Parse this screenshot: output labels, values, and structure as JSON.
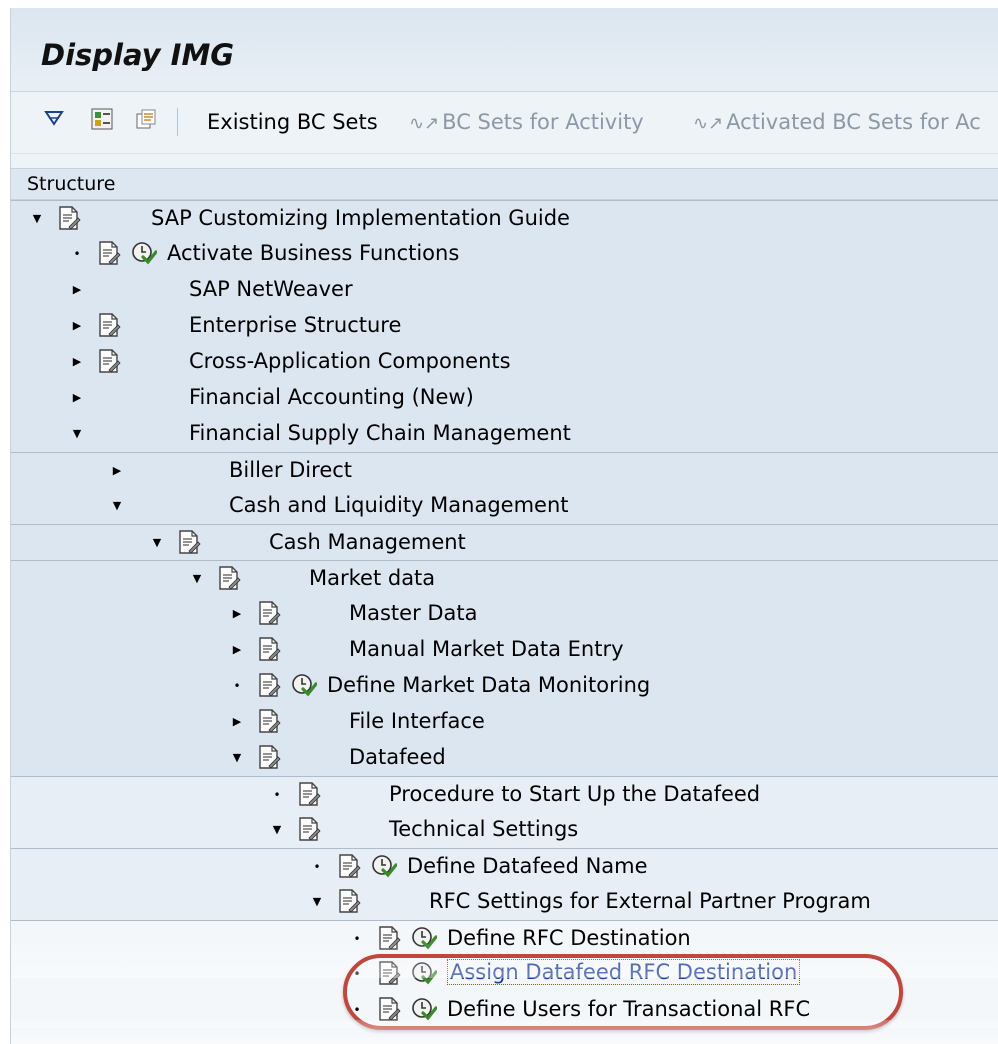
{
  "window": {
    "title": "Display IMG"
  },
  "toolbar": {
    "icons": [
      "find-icon",
      "expand-icon",
      "copy-icon"
    ],
    "buttons": [
      {
        "label": "Existing BC Sets",
        "enabled": true
      },
      {
        "label": "BC Sets for Activity",
        "enabled": false,
        "icon": "bc-sets-icon"
      },
      {
        "label": "Activated BC Sets for Ac",
        "enabled": false,
        "icon": "bc-sets-icon"
      }
    ]
  },
  "tree": {
    "header": "Structure",
    "rows": [
      {
        "label": "SAP Customizing Implementation Guide",
        "level": 0,
        "toggle": "expanded",
        "doc": true,
        "clock": false
      },
      {
        "label": "Activate Business Functions",
        "level": 1,
        "toggle": "leaf",
        "doc": true,
        "clock": true
      },
      {
        "label": "SAP NetWeaver",
        "level": 1,
        "toggle": "collapsed",
        "doc": false,
        "clock": false
      },
      {
        "label": "Enterprise Structure",
        "level": 1,
        "toggle": "collapsed",
        "doc": true,
        "clock": false
      },
      {
        "label": "Cross-Application Components",
        "level": 1,
        "toggle": "collapsed",
        "doc": true,
        "clock": false
      },
      {
        "label": "Financial Accounting (New)",
        "level": 1,
        "toggle": "collapsed",
        "doc": false,
        "clock": false
      },
      {
        "label": "Financial Supply Chain Management",
        "level": 1,
        "toggle": "expanded",
        "doc": false,
        "clock": false
      },
      {
        "label": "Biller Direct",
        "level": 2,
        "toggle": "collapsed",
        "doc": false,
        "clock": false
      },
      {
        "label": "Cash and Liquidity Management",
        "level": 2,
        "toggle": "expanded",
        "doc": false,
        "clock": false
      },
      {
        "label": "Cash Management",
        "level": 3,
        "toggle": "expanded",
        "doc": true,
        "clock": false
      },
      {
        "label": "Market data",
        "level": 4,
        "toggle": "expanded",
        "doc": true,
        "clock": false
      },
      {
        "label": "Master Data",
        "level": 5,
        "toggle": "collapsed",
        "doc": true,
        "clock": false
      },
      {
        "label": "Manual Market Data Entry",
        "level": 5,
        "toggle": "collapsed",
        "doc": true,
        "clock": false
      },
      {
        "label": "Define Market Data Monitoring",
        "level": 5,
        "toggle": "leaf",
        "doc": true,
        "clock": true
      },
      {
        "label": "File Interface",
        "level": 5,
        "toggle": "collapsed",
        "doc": true,
        "clock": false
      },
      {
        "label": "Datafeed",
        "level": 5,
        "toggle": "expanded",
        "doc": true,
        "clock": false
      },
      {
        "label": "Procedure to Start Up the Datafeed",
        "level": 6,
        "toggle": "leaf",
        "doc": true,
        "clock": false
      },
      {
        "label": "Technical Settings",
        "level": 6,
        "toggle": "expanded",
        "doc": true,
        "clock": false
      },
      {
        "label": "Define Datafeed Name",
        "level": 7,
        "toggle": "leaf",
        "doc": true,
        "clock": true
      },
      {
        "label": "RFC Settings for External Partner Program",
        "level": 7,
        "toggle": "expanded",
        "doc": true,
        "clock": false
      },
      {
        "label": "Define RFC Destination",
        "level": 8,
        "toggle": "leaf",
        "doc": true,
        "clock": true
      },
      {
        "label": "Assign Datafeed RFC Destination",
        "level": 8,
        "toggle": "leaf",
        "doc": true,
        "clock": true,
        "selected": true
      },
      {
        "label": "Define Users for Transactional RFC",
        "level": 8,
        "toggle": "leaf",
        "doc": true,
        "clock": true
      }
    ]
  },
  "colors": {
    "link": "#1c3f98",
    "highlight_oval": "#c0473e",
    "clock_green": "#3a8a2a"
  }
}
